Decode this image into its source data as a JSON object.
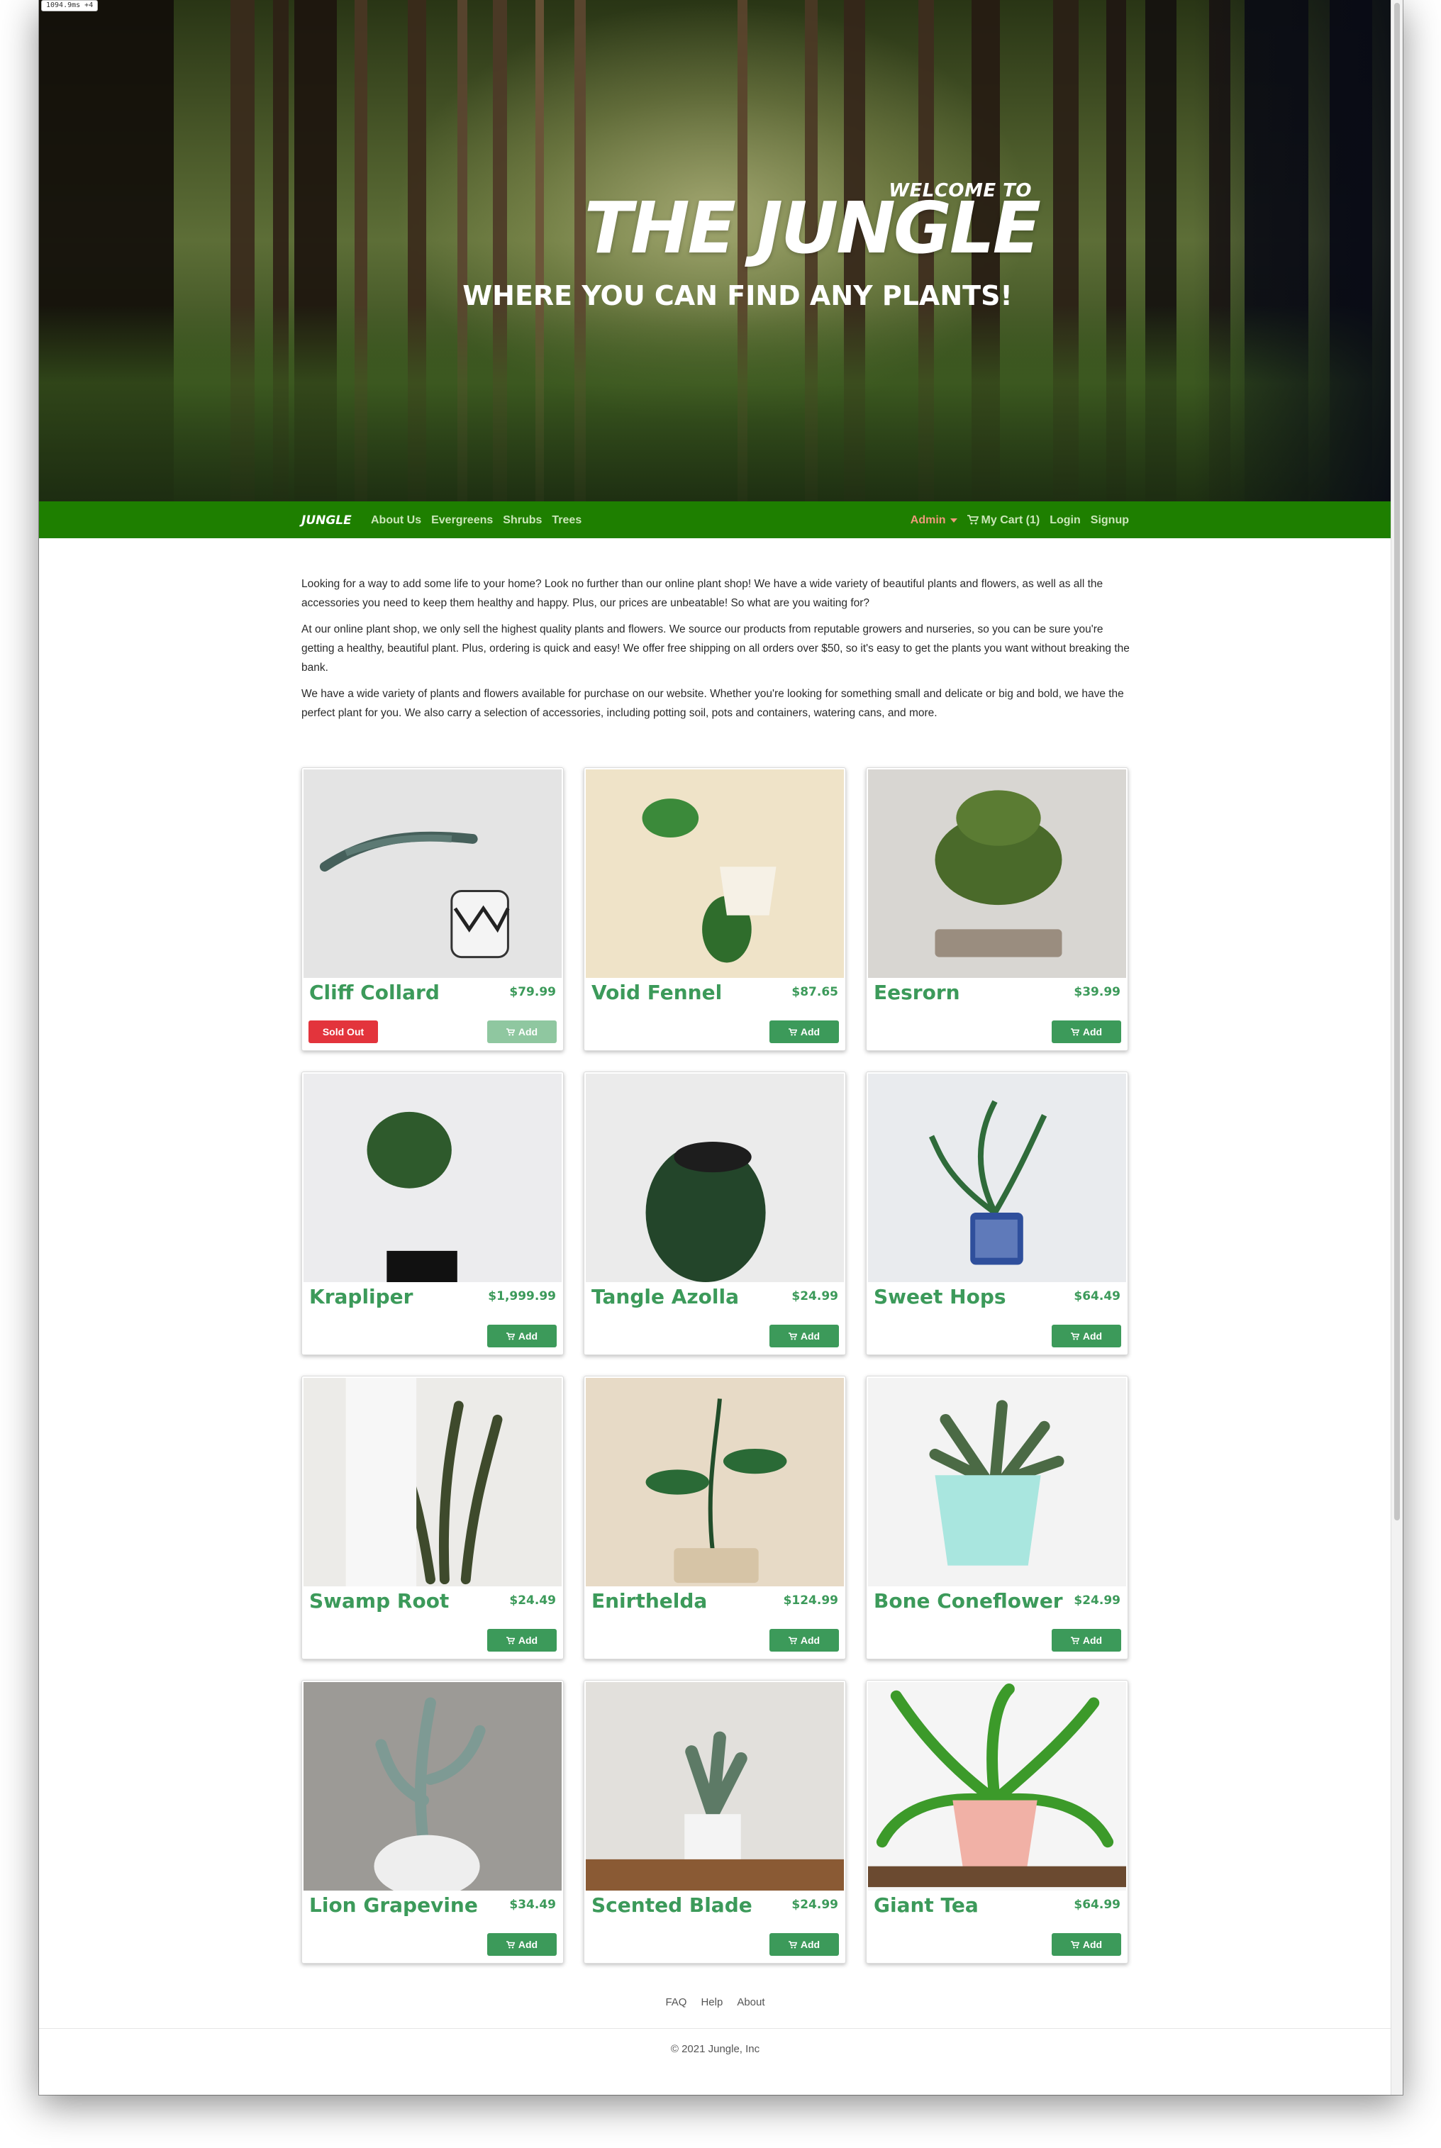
{
  "badge": "1094.9ms +4",
  "hero": {
    "welcome": "WELCOME TO",
    "title": "THE JUNGLE",
    "subtitle": "WHERE YOU CAN FIND ANY PLANTS!"
  },
  "navbar": {
    "brand": "JUNGLE",
    "left_links": [
      "About Us",
      "Evergreens",
      "Shrubs",
      "Trees"
    ],
    "admin": "Admin",
    "cart": "My Cart (1)",
    "login": "Login",
    "signup": "Signup"
  },
  "intro": [
    "Looking for a way to add some life to your home? Look no further than our online plant shop! We have a wide variety of beautiful plants and flowers, as well as all the accessories you need to keep them healthy and happy. Plus, our prices are unbeatable! So what are you waiting for?",
    "At our online plant shop, we only sell the highest quality plants and flowers. We source our products from reputable growers and nurseries, so you can be sure you're getting a healthy, beautiful plant. Plus, ordering is quick and easy! We offer free shipping on all orders over $50, so it's easy to get the plants you want without breaking the bank.",
    "We have a wide variety of plants and flowers available for purchase on our website. Whether you're looking for something small and delicate or big and bold, we have the perfect plant for you. We also carry a selection of accessories, including potting soil, pots and containers, watering cans, and more."
  ],
  "labels": {
    "add": "Add",
    "sold_out": "Sold Out"
  },
  "products": [
    {
      "name": "Cliff Collard",
      "price": "$79.99",
      "sold_out": true
    },
    {
      "name": "Void Fennel",
      "price": "$87.65",
      "sold_out": false
    },
    {
      "name": "Eesrorn",
      "price": "$39.99",
      "sold_out": false
    },
    {
      "name": "Krapliper",
      "price": "$1,999.99",
      "sold_out": false
    },
    {
      "name": "Tangle Azolla",
      "price": "$24.99",
      "sold_out": false
    },
    {
      "name": "Sweet Hops",
      "price": "$64.49",
      "sold_out": false
    },
    {
      "name": "Swamp Root",
      "price": "$24.49",
      "sold_out": false
    },
    {
      "name": "Enirthelda",
      "price": "$124.99",
      "sold_out": false
    },
    {
      "name": "Bone Coneflower",
      "price": "$24.99",
      "sold_out": false
    },
    {
      "name": "Lion Grapevine",
      "price": "$34.49",
      "sold_out": false
    },
    {
      "name": "Scented Blade",
      "price": "$24.99",
      "sold_out": false
    },
    {
      "name": "Giant Tea",
      "price": "$64.99",
      "sold_out": false
    }
  ],
  "footer": {
    "links": [
      "FAQ",
      "Help",
      "About"
    ],
    "copyright": "© 2021 Jungle, Inc"
  },
  "colors": {
    "navbar": "#1e7f00",
    "accent": "#3c9a5a",
    "sold_out": "#e3343c",
    "admin": "#ef9a7a"
  }
}
